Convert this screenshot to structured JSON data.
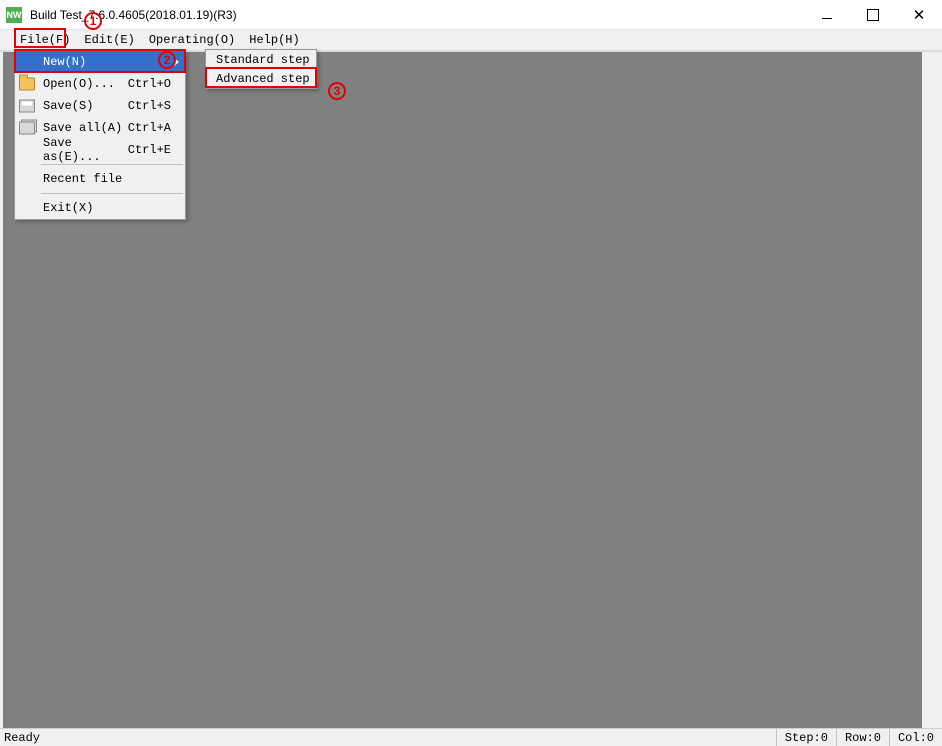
{
  "title": "Build Test_7.6.0.4605(2018.01.19)(R3)",
  "app_icon_text": "NW",
  "menubar": {
    "file": "File(F)",
    "edit": "Edit(E)",
    "operating": "Operating(O)",
    "help": "Help(H)"
  },
  "file_menu": {
    "new": {
      "label": "New(N)"
    },
    "open": {
      "label": "Open(O)...",
      "shortcut": "Ctrl+O"
    },
    "save": {
      "label": "Save(S)",
      "shortcut": "Ctrl+S"
    },
    "save_all": {
      "label": "Save all(A)",
      "shortcut": "Ctrl+A"
    },
    "save_as": {
      "label": "Save as(E)...",
      "shortcut": "Ctrl+E"
    },
    "recent": {
      "label": "Recent file"
    },
    "exit": {
      "label": "Exit(X)"
    }
  },
  "new_submenu": {
    "standard": "Standard step",
    "advanced": "Advanced step"
  },
  "statusbar": {
    "ready": "Ready",
    "step": "Step:0",
    "row": "Row:0",
    "col": "Col:0"
  },
  "annotations": {
    "n1": "1",
    "n2": "2",
    "n3": "3"
  }
}
